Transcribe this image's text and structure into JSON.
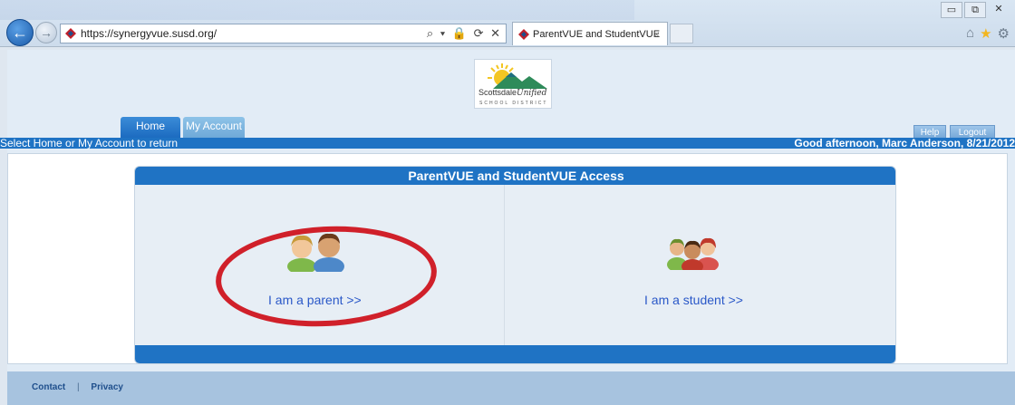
{
  "browser": {
    "url": "https://synergyvue.susd.org/",
    "tab_title": "ParentVUE and StudentVUE",
    "tab_close": "×",
    "back_glyph": "←",
    "forward_glyph": "→",
    "address_actions": "⌕ ▾ 🔒 ⟳ ✕",
    "window_controls": {
      "minimize": "▭",
      "restore": "⧉",
      "close": "✕"
    },
    "chrome_icons": {
      "home": "⌂",
      "favorites": "★",
      "settings": "⚙"
    }
  },
  "header": {
    "logo": {
      "text_main": "Scottsdale",
      "text_script": "Unified",
      "text_sub": "SCHOOL DISTRICT"
    },
    "tabs": [
      {
        "label": "Home"
      },
      {
        "label": "My Account"
      }
    ],
    "buttons": {
      "help": "Help",
      "logout": "Logout"
    },
    "status_left": "Select Home or My Account to return",
    "greeting": "Good afternoon, Marc Anderson, 8/21/2012"
  },
  "card": {
    "title": "ParentVUE and StudentVUE Access",
    "parent_link": "I am a parent >>",
    "student_link": "I am a student >>"
  },
  "footer": {
    "contact": "Contact",
    "separator": "|",
    "privacy": "Privacy"
  },
  "colors": {
    "brand_blue": "#1f73c4",
    "annotation_red": "#d0202a",
    "link_blue": "#2a58c8"
  }
}
